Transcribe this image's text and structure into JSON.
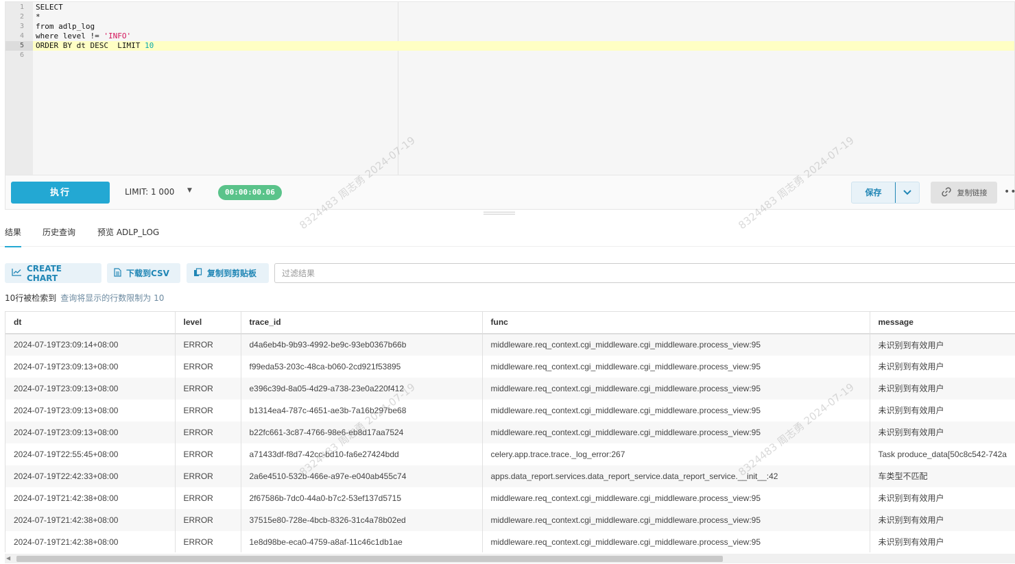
{
  "editor": {
    "lines": [
      {
        "num": "1",
        "parts": [
          {
            "t": "SELECT",
            "c": ""
          }
        ]
      },
      {
        "num": "2",
        "parts": [
          {
            "t": "*",
            "c": ""
          }
        ]
      },
      {
        "num": "3",
        "parts": [
          {
            "t": "from adlp_log",
            "c": ""
          }
        ]
      },
      {
        "num": "4",
        "parts": [
          {
            "t": "where level != ",
            "c": ""
          },
          {
            "t": "'INFO'",
            "c": "tok-str"
          }
        ]
      },
      {
        "num": "5",
        "parts": [
          {
            "t": "ORDER BY dt DESC  LIMIT ",
            "c": ""
          },
          {
            "t": "10",
            "c": "tok-num"
          }
        ],
        "active": true
      },
      {
        "num": "6",
        "parts": []
      }
    ]
  },
  "toolbar": {
    "run_label": "执行",
    "limit_label": "LIMIT:  1 000",
    "timer": "00:00:00.06",
    "save_label": "保存",
    "copy_link_label": "复制链接",
    "more": "•••"
  },
  "tabs": [
    {
      "label": "结果",
      "active": true
    },
    {
      "label": "历史查询",
      "active": false
    },
    {
      "label": "预览 ADLP_LOG",
      "active": false
    }
  ],
  "actions": {
    "create_chart": "CREATE CHART",
    "download_csv": "下载到CSV",
    "copy_clipboard": "复制到剪贴板",
    "filter_placeholder": "过滤结果"
  },
  "rowcount": {
    "count_text": "10行被检索到",
    "limit_note": "查询将显示的行数限制为 10"
  },
  "table": {
    "columns": [
      "dt",
      "level",
      "trace_id",
      "func",
      "message"
    ],
    "rows": [
      [
        "2024-07-19T23:09:14+08:00",
        "ERROR",
        "d4a6eb4b-9b93-4992-be9c-93eb0367b66b",
        "middleware.req_context.cgi_middleware.cgi_middleware.process_view:95",
        "未识别到有效用户"
      ],
      [
        "2024-07-19T23:09:13+08:00",
        "ERROR",
        "f99eda53-203c-48ca-b060-2cd921f53895",
        "middleware.req_context.cgi_middleware.cgi_middleware.process_view:95",
        "未识别到有效用户"
      ],
      [
        "2024-07-19T23:09:13+08:00",
        "ERROR",
        "e396c39d-8a05-4d29-a738-23e0a220f412",
        "middleware.req_context.cgi_middleware.cgi_middleware.process_view:95",
        "未识别到有效用户"
      ],
      [
        "2024-07-19T23:09:13+08:00",
        "ERROR",
        "b1314ea4-787c-4651-ae3b-7a16b297be68",
        "middleware.req_context.cgi_middleware.cgi_middleware.process_view:95",
        "未识别到有效用户"
      ],
      [
        "2024-07-19T23:09:13+08:00",
        "ERROR",
        "b22fc661-3c87-4766-98e6-eb8d17aa7524",
        "middleware.req_context.cgi_middleware.cgi_middleware.process_view:95",
        "未识别到有效用户"
      ],
      [
        "2024-07-19T22:55:45+08:00",
        "ERROR",
        "a71433df-f8d7-42cc-bd10-fa6e27424bdd",
        "celery.app.trace.trace._log_error:267",
        "Task produce_data[50c8c542-742a"
      ],
      [
        "2024-07-19T22:42:33+08:00",
        "ERROR",
        "2a6e4510-532b-466e-a97e-e040ab455c74",
        "apps.data_report.services.data_report_service.data_report_service.__init__:42",
        "车类型不匹配"
      ],
      [
        "2024-07-19T21:42:38+08:00",
        "ERROR",
        "2f67586b-7dc0-44a0-b7c2-53ef137d5715",
        "middleware.req_context.cgi_middleware.cgi_middleware.process_view:95",
        "未识别到有效用户"
      ],
      [
        "2024-07-19T21:42:38+08:00",
        "ERROR",
        "37515e80-728e-4bcb-8326-31c4a78b02ed",
        "middleware.req_context.cgi_middleware.cgi_middleware.process_view:95",
        "未识别到有效用户"
      ],
      [
        "2024-07-19T21:42:38+08:00",
        "ERROR",
        "1e8d98be-eca0-4759-a8af-11c46c1db1ae",
        "middleware.req_context.cgi_middleware.cgi_middleware.process_view:95",
        "未识别到有效用户"
      ]
    ]
  },
  "watermark": "8324483 周志勇 2024-07-19"
}
